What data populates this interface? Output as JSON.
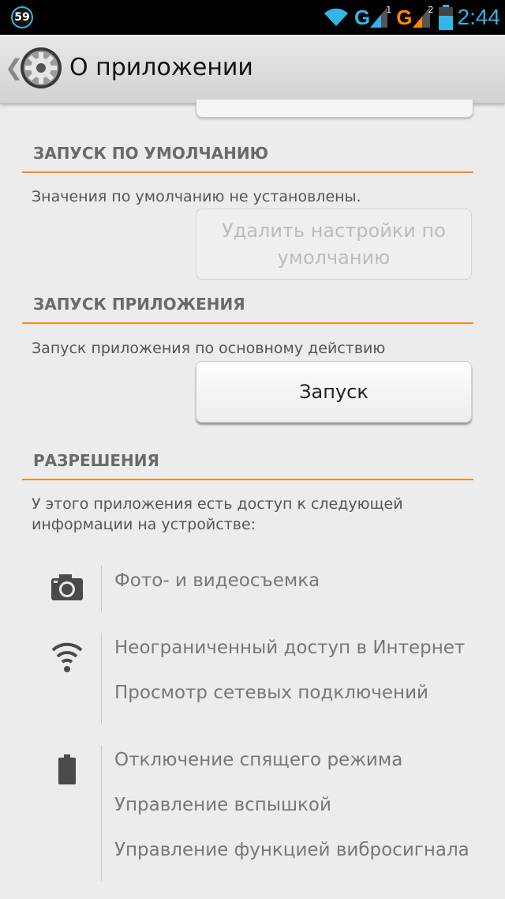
{
  "statusbar": {
    "notification_count": "59",
    "sim1_type": "G",
    "sim1_num": "1",
    "sim2_type": "G",
    "sim2_num": "2",
    "time": "2:44"
  },
  "actionbar": {
    "title": "О приложении"
  },
  "default_launch": {
    "header": "ЗАПУСК ПО УМОЛЧАНИЮ",
    "description": "Значения по умолчанию не установлены.",
    "clear_button_line1": "Удалить настройки по",
    "clear_button_line2": "умолчанию"
  },
  "app_launch": {
    "header": "ЗАПУСК ПРИЛОЖЕНИЯ",
    "description": "Запуск приложения по основному действию",
    "launch_button": "Запуск"
  },
  "permissions": {
    "header": "РАЗРЕШЕНИЯ",
    "description_line1": "У этого приложения есть доступ к следующей",
    "description_line2": "информации на устройстве:",
    "groups": [
      {
        "icon": "camera-icon",
        "items": [
          "Фото- и видеосъемка"
        ]
      },
      {
        "icon": "wifi-icon",
        "items": [
          "Неограниченный доступ в Интернет",
          "Просмотр сетевых подключений"
        ]
      },
      {
        "icon": "battery-icon",
        "items": [
          "Отключение спящего режима",
          "Управление вспышкой",
          "Управление функцией вибросигнала"
        ]
      }
    ]
  },
  "colors": {
    "accent_orange": "#ff8a1c",
    "status_blue": "#33b5e5"
  }
}
